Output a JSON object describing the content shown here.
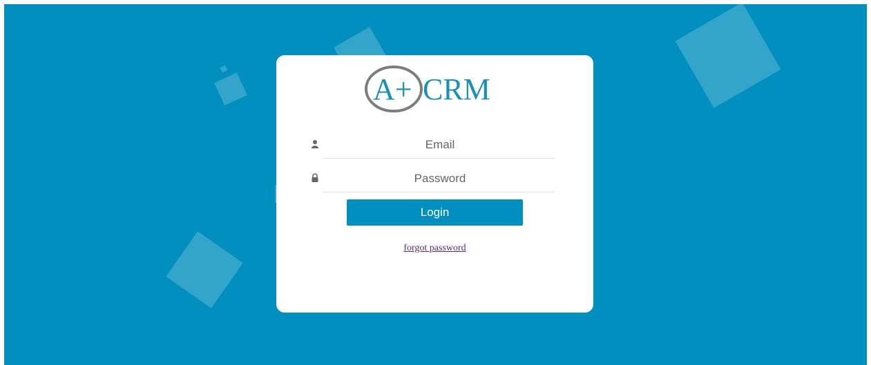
{
  "brand": {
    "logo_mark": "A+",
    "logo_text": "CRM"
  },
  "login_form": {
    "email": {
      "placeholder": "Email",
      "value": "",
      "icon": "user-icon"
    },
    "password": {
      "placeholder": "Password",
      "value": "",
      "icon": "lock-icon"
    },
    "login_label": "Login",
    "forgot_label": "forgot password"
  },
  "colors": {
    "background": "#008fbe",
    "button": "#008fbe",
    "logo_text": "#1a8fb8",
    "logo_ring": "#808080",
    "link": "#5c2d6e"
  }
}
